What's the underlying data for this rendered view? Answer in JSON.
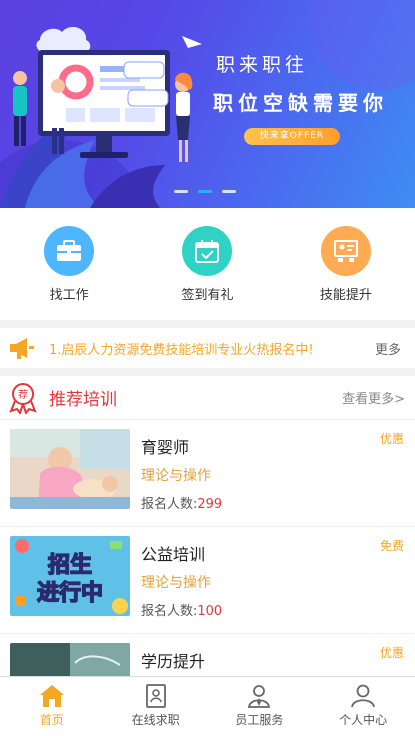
{
  "banner": {
    "title": "职来职往",
    "subtitle": "职位空缺需要你",
    "button_label": "快来拿OFFER",
    "slides": 3,
    "active_slide": 2
  },
  "quick_menu": [
    {
      "label": "找工作",
      "icon": "briefcase-icon",
      "color": "#4db6ff"
    },
    {
      "label": "签到有礼",
      "icon": "calendar-check-icon",
      "color": "#2ed3c6"
    },
    {
      "label": "技能提升",
      "icon": "presentation-icon",
      "color": "#ffab54"
    }
  ],
  "notice": {
    "text": "1.启辰人力资源免费技能培训专业火热报名中!",
    "more_label": "更多",
    "icon": "megaphone-icon",
    "color": "#f5a623"
  },
  "section": {
    "title": "推荐培训",
    "more_label": "查看更多>",
    "badge_text": "荐",
    "color": "#e0383e"
  },
  "trainings": [
    {
      "name": "育婴师",
      "tag": "优惠",
      "subtitle": "理论与操作",
      "count_label": "报名人数:",
      "count": "299",
      "thumb": "nursery-photo"
    },
    {
      "name": "公益培训",
      "tag": "免费",
      "subtitle": "理论与操作",
      "count_label": "报名人数:",
      "count": "100",
      "thumb": "enrollment-poster",
      "thumb_text": "招生进行中"
    },
    {
      "name": "学历提升",
      "tag": "优惠",
      "subtitle": "",
      "count_label": "",
      "count": "",
      "thumb": "education-photo"
    }
  ],
  "tabbar": [
    {
      "label": "首页",
      "icon": "home-icon",
      "active": true
    },
    {
      "label": "在线求职",
      "icon": "resume-icon",
      "active": false
    },
    {
      "label": "员工服务",
      "icon": "staff-icon",
      "active": false
    },
    {
      "label": "个人中心",
      "icon": "user-icon",
      "active": false
    }
  ],
  "accent_color": "#f5a623"
}
